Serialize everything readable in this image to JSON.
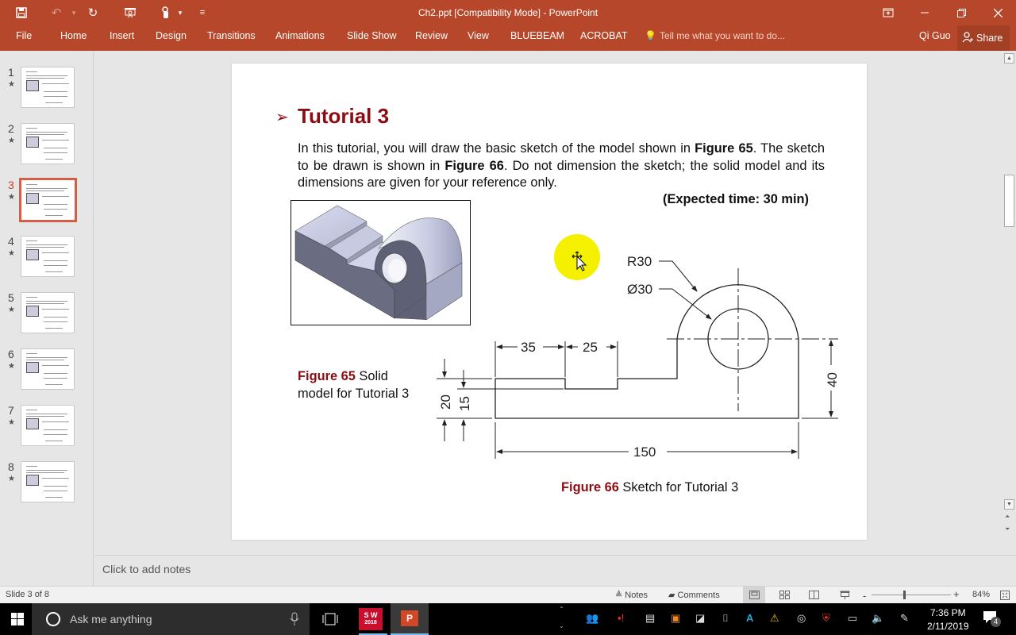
{
  "window": {
    "title": "Ch2.ppt [Compatibility Mode] - PowerPoint",
    "quick_access": [
      "save-icon",
      "undo-icon",
      "redo-icon",
      "start-from-beginning-icon",
      "touch-mode-icon",
      "customize-qat-icon"
    ],
    "controls": [
      "ribbon-display-options",
      "minimize",
      "restore",
      "close"
    ]
  },
  "ribbon": {
    "tabs": [
      "File",
      "Home",
      "Insert",
      "Design",
      "Transitions",
      "Animations",
      "Slide Show",
      "Review",
      "View",
      "BLUEBEAM",
      "ACROBAT"
    ],
    "tell_me": "Tell me what you want to do...",
    "user": "Qi Guo",
    "share": "Share"
  },
  "thumbnails": {
    "items": [
      {
        "number": "1",
        "star": "★"
      },
      {
        "number": "2",
        "star": "★"
      },
      {
        "number": "3",
        "star": "★"
      },
      {
        "number": "4",
        "star": "★"
      },
      {
        "number": "5",
        "star": "★"
      },
      {
        "number": "6",
        "star": "★"
      },
      {
        "number": "7",
        "star": "★"
      },
      {
        "number": "8",
        "star": "★"
      }
    ],
    "selected": 3
  },
  "slide": {
    "bullet": "➢",
    "title": "Tutorial 3",
    "para": {
      "t1": "In this tutorial, you will draw the basic sketch of the model shown in ",
      "b1": "Figure 65",
      "t2": ". The sketch to be drawn is shown in ",
      "b2": "Figure 66",
      "t3": ". Do not dimension the sketch; the solid model and its dimensions are given for your reference only."
    },
    "expected_time": "(Expected time: 30 min)",
    "fig65": {
      "label": "Figure 65",
      "text1": " Solid",
      "text2": "model for Tutorial 3"
    },
    "fig66": {
      "label": "Figure 66",
      "text": " Sketch for Tutorial 3"
    },
    "dimensions": {
      "r30": "R30",
      "d30": "Ø30",
      "d35": "35",
      "d25": "25",
      "d20": "20",
      "d15": "15",
      "d40": "40",
      "d150": "150"
    }
  },
  "notes": {
    "placeholder": "Click to add notes"
  },
  "status": {
    "slide_info": "Slide 3 of 8",
    "notes_label": "Notes",
    "comments_label": "Comments",
    "zoom": "84%",
    "zoom_minus": "-",
    "zoom_plus": "+"
  },
  "taskbar": {
    "search_placeholder": "Ask me anything",
    "apps": [
      "SOLIDWORKS 2018",
      "PowerPoint"
    ],
    "sw_label": "S W",
    "sw_year": "2018",
    "time": "7:36 PM",
    "date": "2/11/2019",
    "notification_count": "4"
  }
}
